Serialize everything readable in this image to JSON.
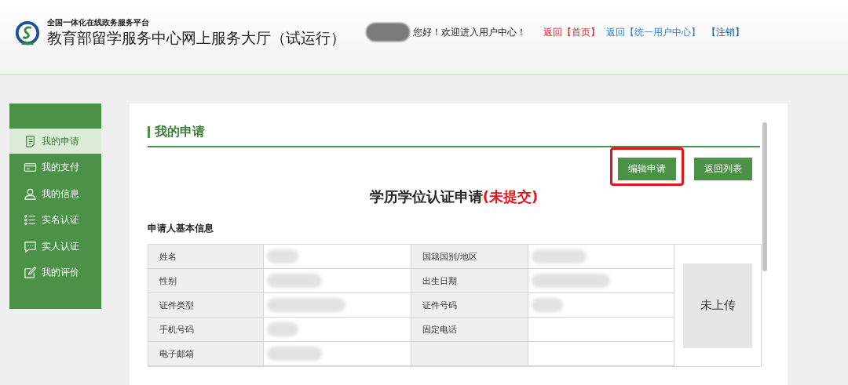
{
  "header": {
    "platform": "全国一体化在线政务服务平台",
    "title": "教育部留学服务中心网上服务大厅（试运行）",
    "greeting": "您好！欢迎进入用户中心！",
    "links": [
      {
        "label": "返回【首页】",
        "color": "#e8232a"
      },
      {
        "label": "返回【统一用户中心】",
        "color": "#2a7fd4"
      },
      {
        "label": "【注销】",
        "color": "#1a5fa8"
      }
    ]
  },
  "sidebar": {
    "items": [
      {
        "label": "我的申请",
        "selected": true
      },
      {
        "label": "我的支付",
        "selected": false
      },
      {
        "label": "我的信息",
        "selected": false
      },
      {
        "label": "实名认证",
        "selected": false
      },
      {
        "label": "实人认证",
        "selected": false
      },
      {
        "label": "我的评价",
        "selected": false
      }
    ]
  },
  "main": {
    "section_title": "我的申请",
    "buttons": [
      {
        "label": "编辑申请",
        "highlighted": true
      },
      {
        "label": "返回列表",
        "highlighted": false
      }
    ],
    "form_title": "学历学位认证申请",
    "form_status": "(未提交)",
    "group_title": "申请人基本信息",
    "rows": [
      {
        "cells": [
          {
            "label": "姓名",
            "redacted": true
          },
          {
            "label": "国籍国别/地区",
            "redacted": true
          }
        ]
      },
      {
        "cells": [
          {
            "label": "性别",
            "redacted": true
          },
          {
            "label": "出生日期",
            "redacted": true
          }
        ]
      },
      {
        "cells": [
          {
            "label": "证件类型",
            "redacted": true
          },
          {
            "label": "证件号码",
            "redacted": true
          }
        ]
      },
      {
        "cells": [
          {
            "label": "手机号码",
            "redacted": true
          },
          {
            "label": "固定电话",
            "redacted": false
          }
        ]
      },
      {
        "cells": [
          {
            "label": "电子邮箱",
            "redacted": true
          },
          {
            "redacted": false
          }
        ]
      }
    ],
    "photo": "未上传"
  }
}
